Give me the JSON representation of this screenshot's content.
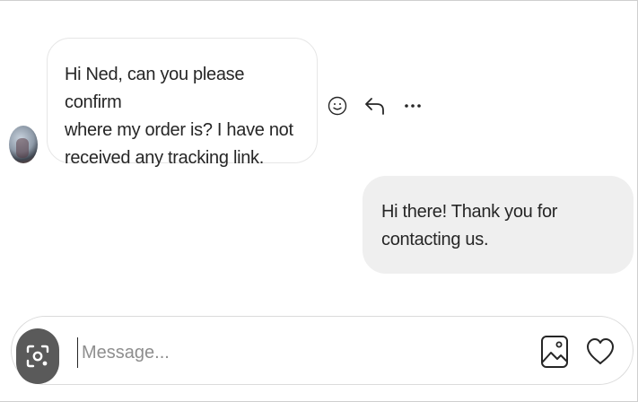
{
  "conversation": {
    "incoming": {
      "text": "Hi Ned, can you please confirm\nwhere my order is? I have not\nreceived any tracking link."
    },
    "outgoing": {
      "text": "Hi there! Thank you for\ncontacting us."
    }
  },
  "message_actions": {
    "react_icon": "smiley-icon",
    "reply_icon": "reply-arrow-icon",
    "more_icon": "more-dots-icon"
  },
  "composer": {
    "placeholder": "Message...",
    "value": "",
    "left_icon": "lens-icon",
    "image_icon": "image-icon",
    "like_icon": "heart-icon"
  },
  "colors": {
    "incoming_bubble": "#ffffff",
    "outgoing_bubble": "#efefef",
    "text": "#262626",
    "placeholder": "#8e8e8e"
  }
}
